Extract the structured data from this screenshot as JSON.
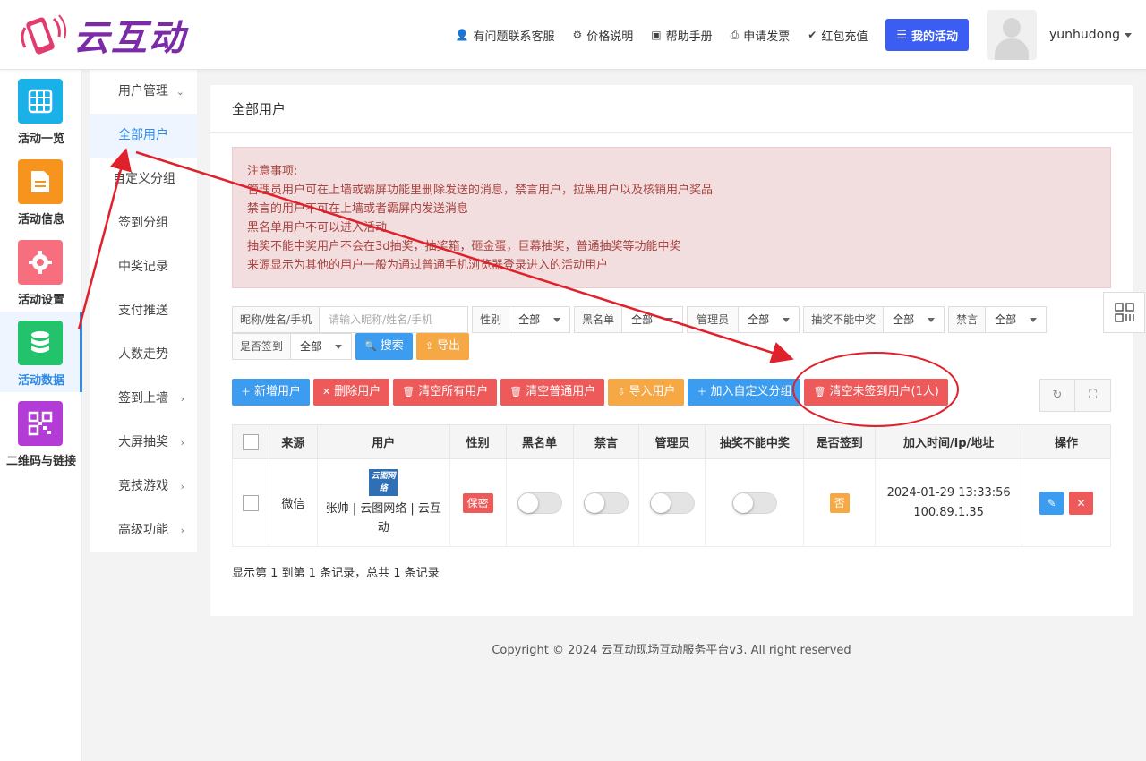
{
  "brand": {
    "logo_text": "云互动"
  },
  "topnav": {
    "items": [
      {
        "label": "有问题联系客服",
        "icon": "user-plus-icon"
      },
      {
        "label": "价格说明",
        "icon": "gear-icon"
      },
      {
        "label": "帮助手册",
        "icon": "book-icon"
      },
      {
        "label": "申请发票",
        "icon": "printer-icon"
      },
      {
        "label": "红包充值",
        "icon": "shield-check-icon"
      }
    ],
    "my_activity": "我的活动",
    "username": "yunhudong"
  },
  "rail": {
    "items": [
      {
        "label": "活动一览",
        "icon": "grid-icon",
        "color": "#1ab0e8"
      },
      {
        "label": "活动信息",
        "icon": "document-icon",
        "color": "#f7941d"
      },
      {
        "label": "活动设置",
        "icon": "gear-icon",
        "color": "#f76f7f"
      },
      {
        "label": "活动数据",
        "icon": "database-icon",
        "color": "#22c36a",
        "active": true
      },
      {
        "label": "二维码与链接",
        "icon": "qrcode-icon",
        "color": "#b43cd6"
      }
    ]
  },
  "submenu": {
    "group": "用户管理",
    "items": [
      "全部用户",
      "自定义分组",
      "签到分组",
      "中奖记录",
      "支付推送",
      "人数走势"
    ],
    "groups": [
      "签到上墙",
      "大屏抽奖",
      "竞技游戏",
      "高级功能"
    ]
  },
  "page": {
    "title": "全部用户",
    "notice": [
      "注意事项:",
      "管理员用户可在上墙或霸屏功能里删除发送的消息，禁言用户，拉黑用户以及核销用户奖品",
      "禁言的用户不可在上墙或者霸屏内发送消息",
      "黑名单用户不可以进入活动",
      "抽奖不能中奖用户不会在3d抽奖，抽奖箱，砸金蛋，巨幕抽奖，普通抽奖等功能中奖",
      "来源显示为其他的用户一般为通过普通手机浏览器登录进入的活动用户"
    ]
  },
  "filters": {
    "keyword_label": "昵称/姓名/手机",
    "keyword_placeholder": "请输入昵称/姓名/手机",
    "gender_label": "性别",
    "gender_value": "全部",
    "blacklist_label": "黑名单",
    "blacklist_value": "全部",
    "admin_label": "管理员",
    "admin_value": "全部",
    "nowin_label": "抽奖不能中奖",
    "nowin_value": "全部",
    "mute_label": "禁言",
    "mute_value": "全部",
    "signed_label": "是否签到",
    "signed_value": "全部",
    "search": "搜索",
    "export": "导出"
  },
  "toolbar": {
    "add_user": "新增用户",
    "delete_user": "删除用户",
    "clear_all": "清空所有用户",
    "clear_normal": "清空普通用户",
    "import_user": "导入用户",
    "add_group": "加入自定义分组",
    "clear_unsigned": "清空未签到用户(1人)"
  },
  "table": {
    "headers": [
      "来源",
      "用户",
      "性别",
      "黑名单",
      "禁言",
      "管理员",
      "抽奖不能中奖",
      "是否签到",
      "加入时间/ip/地址",
      "操作"
    ],
    "rows": [
      {
        "source": "微信",
        "user_logo": "云图网络",
        "user": "张帅 | 云图网络 | 云互动",
        "gender": "保密",
        "blacklist": false,
        "mute": false,
        "admin": false,
        "nowin": false,
        "signed": "否",
        "join_time": "2024-01-29 13:33:56",
        "ip": "100.89.1.35"
      }
    ]
  },
  "pager": "显示第 1 到第 1 条记录，总共 1 条记录",
  "footer": "Copyright © 2024 云互动现场互动服务平台v3. All right reserved",
  "colors": {
    "primary": "#3b5df2",
    "danger": "#ee5a5a",
    "warning": "#f5a844",
    "info": "#3c9cf0",
    "annotation": "#e0202a"
  }
}
